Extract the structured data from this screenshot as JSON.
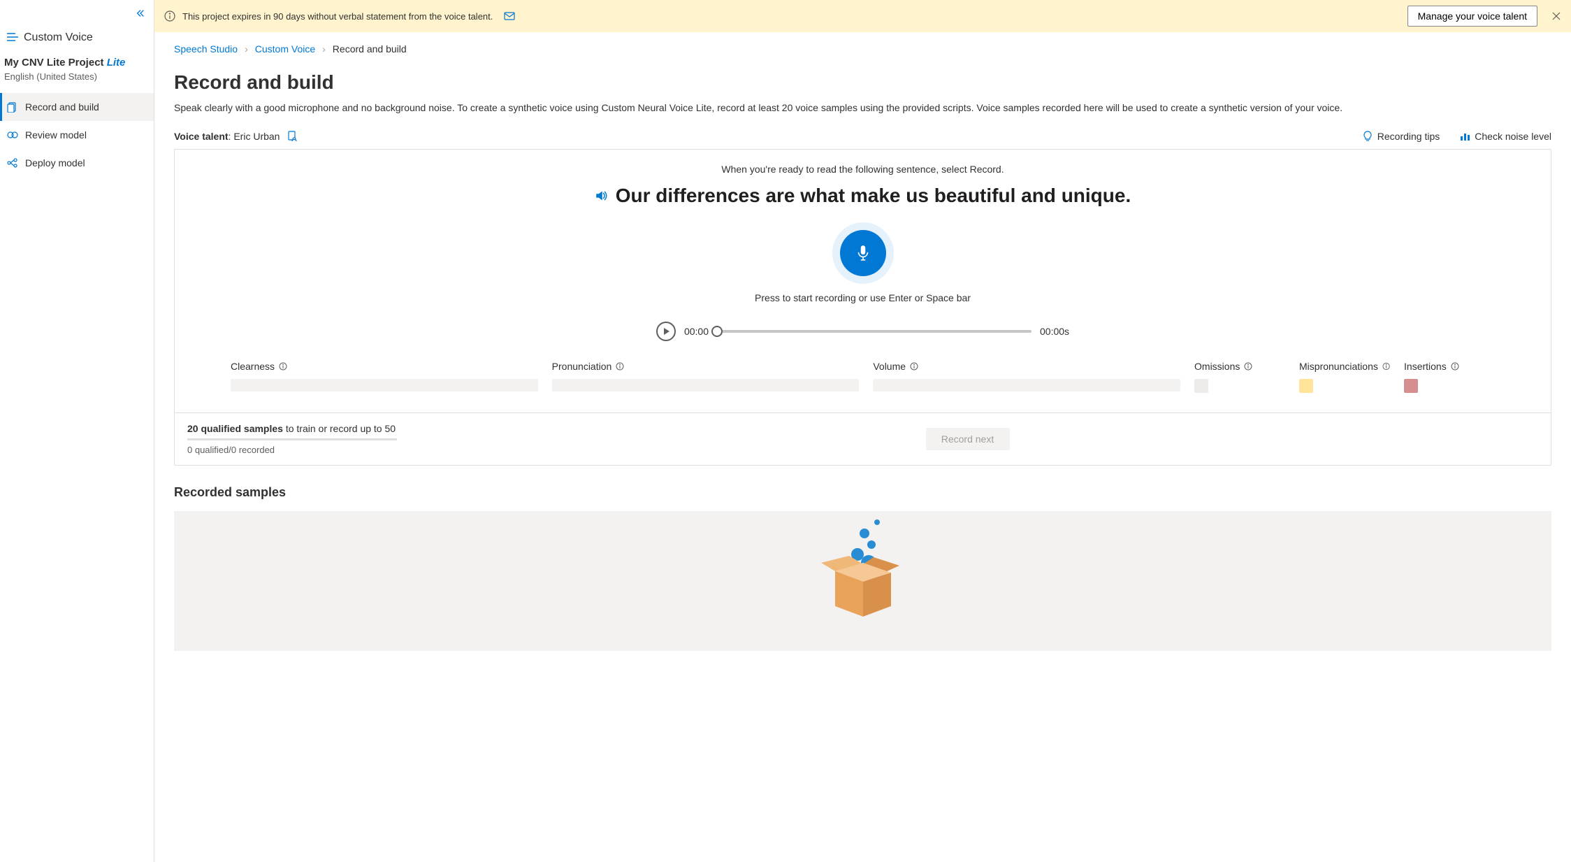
{
  "sidebar": {
    "product": "Custom Voice",
    "project_name": "My CNV Lite Project",
    "project_tag": "Lite",
    "project_lang": "English (United States)",
    "nav": [
      {
        "label": "Record and build",
        "active": true
      },
      {
        "label": "Review model",
        "active": false
      },
      {
        "label": "Deploy model",
        "active": false
      }
    ]
  },
  "banner": {
    "text": "This project expires in 90 days without verbal statement from the voice talent.",
    "button": "Manage your voice talent"
  },
  "breadcrumb": {
    "items": [
      "Speech Studio",
      "Custom Voice",
      "Record and build"
    ]
  },
  "page": {
    "title": "Record and build",
    "description": "Speak clearly with a good microphone and no background noise. To create a synthetic voice using Custom Neural Voice Lite, record at least 20 voice samples using the provided scripts. Voice samples recorded here will be used to create a synthetic version of your voice."
  },
  "toolbar": {
    "voice_talent_label": "Voice talent",
    "voice_talent_name": "Eric Urban",
    "recording_tips": "Recording tips",
    "check_noise": "Check noise level"
  },
  "recorder": {
    "hint": "When you're ready to read the following sentence, select Record.",
    "sentence": "Our differences are what make us beautiful and unique.",
    "mic_hint": "Press to start recording or use Enter or Space bar",
    "time_current": "00:00",
    "time_total": "00:00s",
    "metrics": {
      "clearness": "Clearness",
      "pronunciation": "Pronunciation",
      "volume": "Volume",
      "omissions": "Omissions",
      "mispronunciations": "Mispronunciations",
      "insertions": "Insertions"
    },
    "footer": {
      "bold": "20 qualified samples",
      "rest": " to train or record up to 50",
      "sub": "0 qualified/0 recorded",
      "button": "Record next"
    }
  },
  "samples": {
    "title": "Recorded samples"
  }
}
